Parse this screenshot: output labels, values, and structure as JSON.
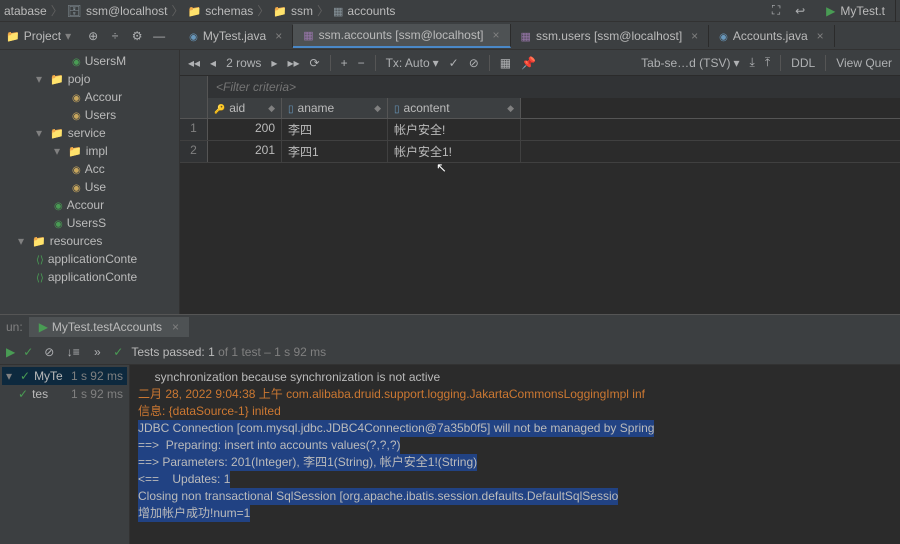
{
  "breadcrumb": {
    "l1": "atabase",
    "l2": "ssm@localhost",
    "l3": "schemas",
    "l4": "ssm",
    "l5": "accounts"
  },
  "top_right_tab": "MyTest.t",
  "project_label": "Project",
  "tabs": {
    "t1": "MyTest.java",
    "t2": "ssm.accounts [ssm@localhost]",
    "t3": "ssm.users [ssm@localhost]",
    "t4": "Accounts.java"
  },
  "tree": {
    "users_m": "UsersM",
    "pojo": "pojo",
    "accounts": "Accour",
    "users": "Users",
    "service": "service",
    "impl": "impl",
    "acc": "Acc",
    "use": "Use",
    "accoun2": "Accour",
    "userss": "UsersS",
    "resources": "resources",
    "appctx1": "applicationConte",
    "appctx2": "applicationConte"
  },
  "query_toolbar": {
    "rows": "2 rows",
    "tx": "Tx: Auto",
    "tab_sep": "Tab-se…d (TSV)",
    "ddl": "DDL",
    "view_query": "View Quer"
  },
  "filter_placeholder": "<Filter criteria>",
  "columns": {
    "aid": "aid",
    "aname": "aname",
    "acontent": "acontent"
  },
  "rows": [
    {
      "n": "1",
      "aid": "200",
      "aname": "李四",
      "acontent": "帐户安全!"
    },
    {
      "n": "2",
      "aid": "201",
      "aname": "李四1",
      "acontent": "帐户安全1!"
    }
  ],
  "run": {
    "label": "un:",
    "tab_name": "MyTest.testAccounts",
    "tests_passed": "Tests passed: 1",
    "tests_total": "of 1 test",
    "tests_time": "– 1 s 92 ms",
    "tree_root": "MyTe",
    "tree_root_time": "1 s 92 ms",
    "tree_item": "tes",
    "tree_item_time": "1 s 92 ms"
  },
  "console": {
    "l1": "     synchronization because synchronization is not active",
    "l2": "二月 28, 2022 9:04:38 上午 com.alibaba.druid.support.logging.JakartaCommonsLoggingImpl inf",
    "l3": "信息: {dataSource-1} inited",
    "l4": "JDBC Connection [com.mysql.jdbc.JDBC4Connection@7a35b0f5] will not be managed by Spring",
    "l5": "==>  Preparing: insert into accounts values(?,?,?)",
    "l6": "==> Parameters: 201(Integer), 李四1(String), 帐户安全1!(String)",
    "l7": "<==    Updates: 1",
    "l8": "Closing non transactional SqlSession [org.apache.ibatis.session.defaults.DefaultSqlSessio",
    "l9": "增加帐户成功!num=1"
  }
}
